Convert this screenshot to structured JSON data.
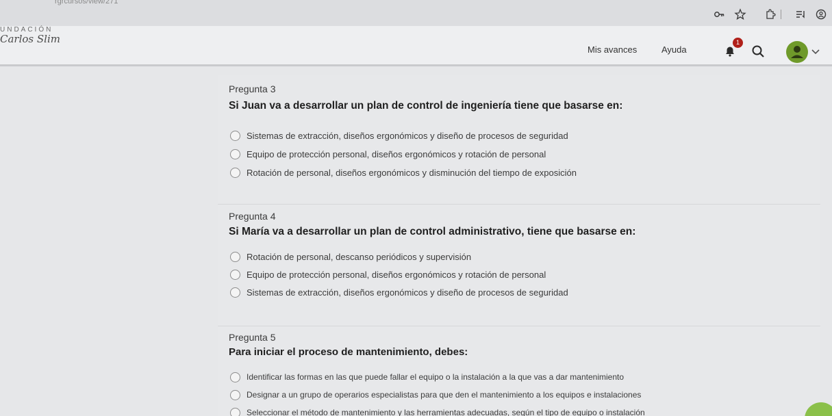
{
  "browser": {
    "url_fragment": "rgrcursos/view/271",
    "icons": [
      "key-icon",
      "star-icon",
      "extensions-icon",
      "reading-list-icon",
      "profile-icon"
    ]
  },
  "header": {
    "logo_top": "UNDACIÓN",
    "logo_script": "Carlos Slim",
    "nav": {
      "progress": "Mis avances",
      "help": "Ayuda"
    },
    "notification_count": "1",
    "accent_color": "#6f9a2a",
    "badge_color": "#b0201a"
  },
  "questions": [
    {
      "number": "Pregunta 3",
      "text": "Si Juan va a desarrollar un plan de control de ingeniería tiene que basarse en:",
      "options": [
        "Sistemas de extracción, diseños ergonómicos y diseño de procesos de seguridad",
        "Equipo de protección personal, diseños ergonómicos y rotación de personal",
        "Rotación de personal, diseños ergonómicos y disminución del tiempo de exposición"
      ]
    },
    {
      "number": "Pregunta 4",
      "text": "Si María va a desarrollar un plan de control administrativo, tiene que basarse en:",
      "options": [
        "Rotación de personal, descanso periódicos y supervisión",
        "Equipo de protección personal, diseños ergonómicos y rotación de personal",
        "Sistemas de extracción, diseños ergonómicos y diseño de procesos de seguridad"
      ]
    },
    {
      "number": "Pregunta 5",
      "text": "Para iniciar el proceso de mantenimiento, debes:",
      "options": [
        "Identificar las formas en las que puede fallar el equipo o la instalación a la que vas a dar mantenimiento",
        "Designar a un grupo de operarios especialistas para que den el mantenimiento a los equipos e instalaciones",
        "Seleccionar el método de mantenimiento y las herramientas adecuadas, según el tipo de equipo o instalación"
      ]
    }
  ]
}
